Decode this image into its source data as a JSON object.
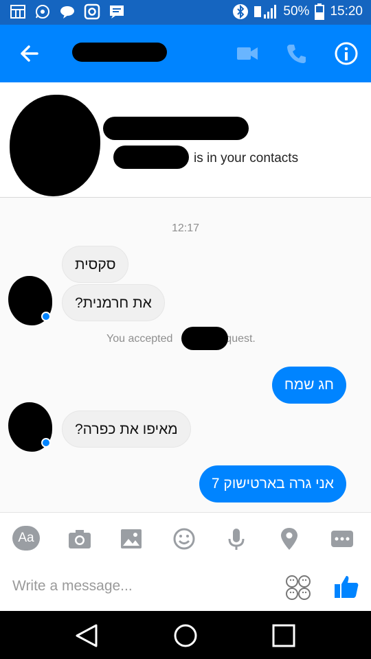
{
  "status_bar": {
    "battery": "50%",
    "time": "15:20",
    "icons_left": [
      "calendar-icon",
      "whatsapp-icon",
      "chat-icon",
      "instagram-icon",
      "message-icon"
    ],
    "icons_right": [
      "bluetooth-icon",
      "signal-icon",
      "battery-icon"
    ]
  },
  "app_bar": {
    "back_icon": "arrow-left-icon",
    "title": "",
    "actions": [
      "video-call-icon",
      "phone-call-icon",
      "info-icon"
    ],
    "color": "#0084ff"
  },
  "contact_header": {
    "subtitle": "is in your contacts"
  },
  "conversation": {
    "timestamp": "12:17",
    "messages": [
      {
        "from": "them",
        "text": "סקסית"
      },
      {
        "from": "them",
        "text": "את חרמנית?"
      },
      {
        "from": "system",
        "text_before": "You accepted",
        "text_after": "equest."
      },
      {
        "from": "me",
        "text": "חג שמח"
      },
      {
        "from": "them",
        "text": "מאיפו את כפרה?"
      },
      {
        "from": "me",
        "text": "אני גרה בארטישוק 7"
      }
    ]
  },
  "toolbar": {
    "aa_label": "Aa",
    "icons": [
      "camera-icon",
      "image-icon",
      "smiley-icon",
      "microphone-icon",
      "location-icon",
      "more-icon"
    ]
  },
  "composer": {
    "placeholder": "Write a message..."
  },
  "nav_bar": {
    "icons": [
      "back-triangle-icon",
      "home-circle-icon",
      "recents-square-icon"
    ]
  }
}
